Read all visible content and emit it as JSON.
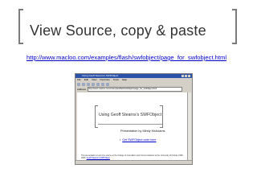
{
  "slide": {
    "title": "View Source, copy & paste",
    "url": "http://www.macloo.com/examples/flash/swfobject/page_for_swfobject.html"
  },
  "browser": {
    "window_title": "Using Geoff Stearns's SWFObject",
    "menu": [
      "File",
      "Edit",
      "View",
      "Favorites",
      "Tools",
      "Help"
    ],
    "address_label": "Address",
    "address_value": "http://www.macloo.com/examples/flash/swfobject/page_for_swfobject.html",
    "page": {
      "title": "Using Geoff Stearns's SWFObject",
      "byline": "Presentation by Mindy McAdams",
      "link_text": "Get SWFObject code here",
      "footer_text": "This presentation is part of a course at the College of Journalism and Communications at the University of Florida. 1999-2006.",
      "footer_link": "Geoff Stearns's SWFObject"
    }
  },
  "colors": {
    "bracket": "#7b7b7b",
    "title": "#333333",
    "link": "#0000cc",
    "browser_chrome": "#d4d0c8",
    "browser_titlebar": "#2a52a8"
  }
}
